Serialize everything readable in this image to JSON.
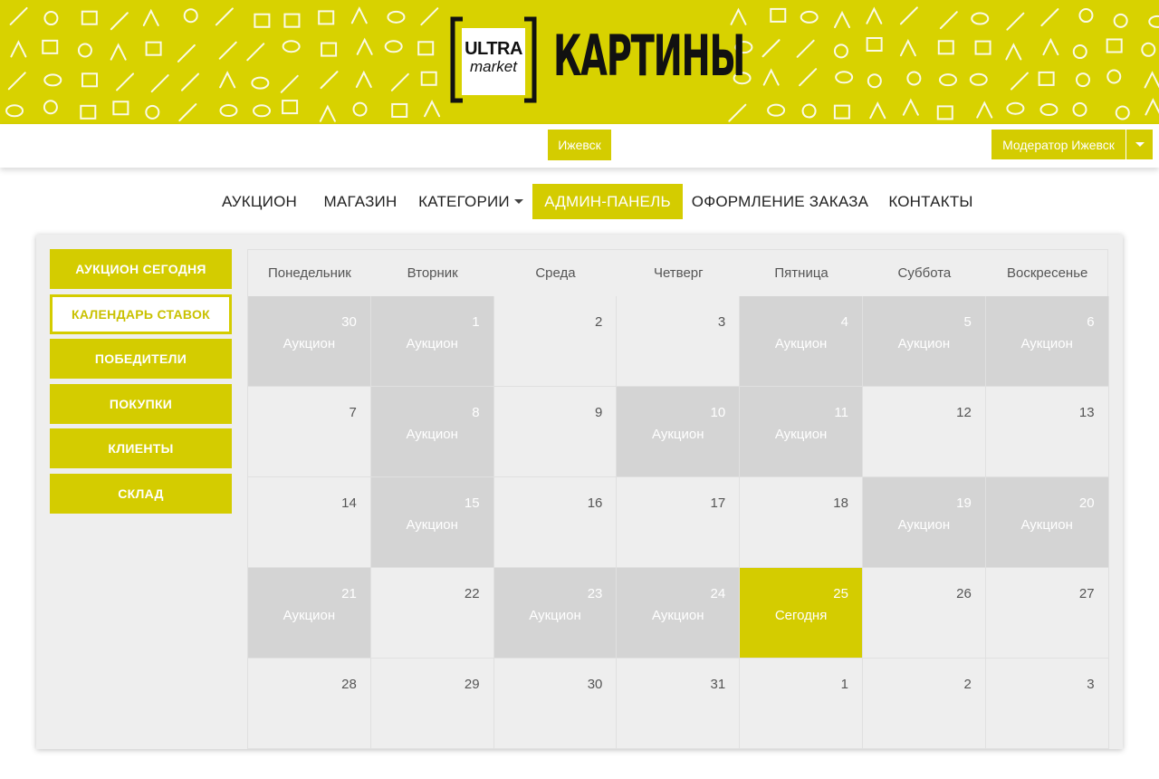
{
  "brand": {
    "logo_line1": "ULTRA",
    "logo_line2": "market",
    "site_title": "КАРТИНЫ",
    "accent_color": "#d4cc00"
  },
  "topbar": {
    "city": "Ижевск",
    "user": "Модератор Ижевск",
    "user_menu_icon": "caret-down-icon"
  },
  "nav": [
    {
      "label": "АУКЦИОН",
      "active": false
    },
    {
      "label": "МАГАЗИН",
      "active": false
    },
    {
      "label": "КАТЕГОРИИ",
      "active": false,
      "has_dropdown": true
    },
    {
      "label": "АДМИН-ПАНЕЛЬ",
      "active": true
    },
    {
      "label": "ОФОРМЛЕНИЕ ЗАКАЗА",
      "active": false
    },
    {
      "label": "КОНТАКТЫ",
      "active": false
    }
  ],
  "sidebar": [
    {
      "label": "АУКЦИОН СЕГОДНЯ",
      "current": false
    },
    {
      "label": "КАЛЕНДАРЬ СТАВОК",
      "current": true
    },
    {
      "label": "ПОБЕДИТЕЛИ",
      "current": false
    },
    {
      "label": "ПОКУПКИ",
      "current": false
    },
    {
      "label": "КЛИЕНТЫ",
      "current": false
    },
    {
      "label": "СКЛАД",
      "current": false
    }
  ],
  "calendar": {
    "weekdays": [
      "Понедельник",
      "Вторник",
      "Среда",
      "Четверг",
      "Пятница",
      "Суббота",
      "Воскресенье"
    ],
    "weeks": [
      [
        {
          "d": "30",
          "s": "auction"
        },
        {
          "d": "1",
          "s": "auction"
        },
        {
          "d": "2",
          "s": ""
        },
        {
          "d": "3",
          "s": ""
        },
        {
          "d": "4",
          "s": "auction"
        },
        {
          "d": "5",
          "s": "auction"
        },
        {
          "d": "6",
          "s": "auction"
        }
      ],
      [
        {
          "d": "7",
          "s": ""
        },
        {
          "d": "8",
          "s": "auction"
        },
        {
          "d": "9",
          "s": ""
        },
        {
          "d": "10",
          "s": "auction"
        },
        {
          "d": "11",
          "s": "auction"
        },
        {
          "d": "12",
          "s": ""
        },
        {
          "d": "13",
          "s": ""
        }
      ],
      [
        {
          "d": "14",
          "s": ""
        },
        {
          "d": "15",
          "s": "auction"
        },
        {
          "d": "16",
          "s": ""
        },
        {
          "d": "17",
          "s": ""
        },
        {
          "d": "18",
          "s": ""
        },
        {
          "d": "19",
          "s": "auction"
        },
        {
          "d": "20",
          "s": "auction"
        }
      ],
      [
        {
          "d": "21",
          "s": "auction"
        },
        {
          "d": "22",
          "s": ""
        },
        {
          "d": "23",
          "s": "auction"
        },
        {
          "d": "24",
          "s": "auction"
        },
        {
          "d": "25",
          "s": "today"
        },
        {
          "d": "26",
          "s": ""
        },
        {
          "d": "27",
          "s": ""
        }
      ],
      [
        {
          "d": "28",
          "s": ""
        },
        {
          "d": "29",
          "s": ""
        },
        {
          "d": "30",
          "s": ""
        },
        {
          "d": "31",
          "s": ""
        },
        {
          "d": "1",
          "s": ""
        },
        {
          "d": "2",
          "s": ""
        },
        {
          "d": "3",
          "s": ""
        }
      ]
    ],
    "auction_label": "Аукцион",
    "today_label": "Сегодня"
  }
}
